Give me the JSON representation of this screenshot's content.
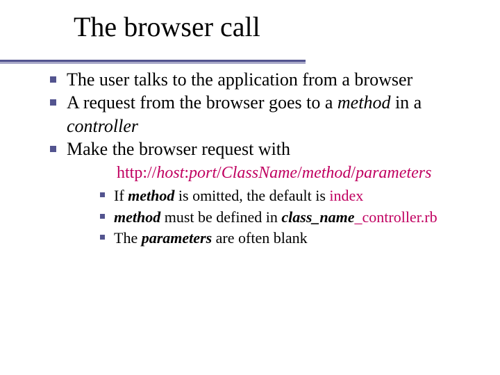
{
  "title": "The browser call",
  "b1": "The user talks to the application from a browser",
  "b2a": "A request from the browser goes to a ",
  "b2b": "method",
  "b2c": " in a ",
  "b2d": "controller",
  "b3": "Make the browser request with",
  "url_http": "http://",
  "url_host": "host",
  "url_colon": ":",
  "url_port": "port",
  "url_s1": "/",
  "url_class": "ClassName",
  "url_s2": "/",
  "url_method": "method",
  "url_s3": "/",
  "url_params": "parameters",
  "s1a": "If ",
  "s1b": "method",
  "s1c": " is omitted, the default is ",
  "s1d": "index",
  "s2a": "method",
  "s2b": " must be defined in ",
  "s2c": "class_name",
  "s2d": "_controller.rb",
  "s3a": "The ",
  "s3b": "parameters",
  "s3c": " are often blank"
}
